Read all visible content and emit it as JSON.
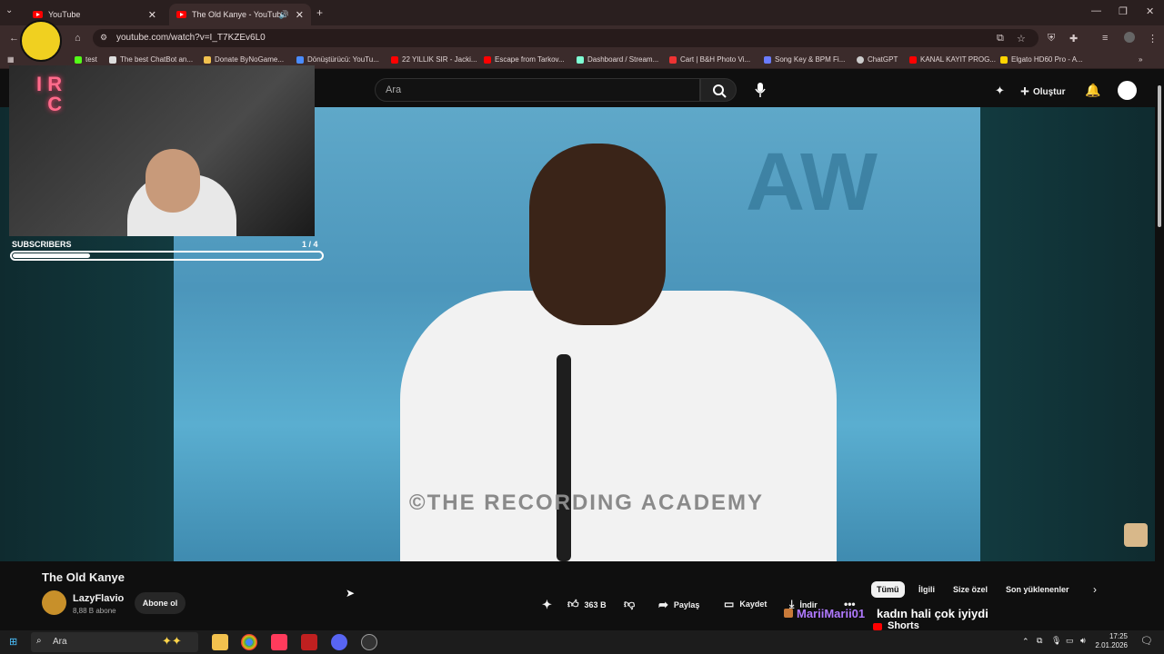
{
  "browser": {
    "tabs": [
      {
        "label": "YouTube",
        "active": false
      },
      {
        "label": "The Old Kanye - YouTube",
        "active": true
      }
    ],
    "url": "youtube.com/watch?v=I_T7KZEv6L0",
    "bookmarks": [
      "test",
      "The best ChatBot an...",
      "Donate ByNoGame...",
      "Dönüştürücü: YouTu...",
      "22 YILLIK SIR - Jacki...",
      "Escape from Tarkov...",
      "Dashboard / Stream...",
      "Cart | B&H Photo Vi...",
      "Song Key & BPM Fi...",
      "ChatGPT",
      "KANAL KAYIT PROG...",
      "Elgato HD60 Pro - A..."
    ]
  },
  "youtube": {
    "search_placeholder": "Ara",
    "create_label": "Oluştur",
    "video_title": "The Old Kanye",
    "channel_name": "LazyFlavio",
    "channel_subs": "8,88 B abone",
    "subscribe_label": "Abone ol",
    "likes": "363 B",
    "share_label": "Paylaş",
    "save_label": "Kaydet",
    "download_label": "İndir",
    "chips": [
      "Tümü",
      "İlgili",
      "Size özel",
      "Son yüklenenler"
    ],
    "video_watermark": "©THE RECORDING ACADEMY"
  },
  "stream_overlay": {
    "brand": "IRONIC",
    "subs_label": "SUBSCRIBERS",
    "subs_count": "1 / 4",
    "subs_progress": 0.25,
    "chat_user": "MariiMarii01",
    "chat_message": "kadın hali çok iyiydi",
    "chat_sub": "Shorts"
  },
  "taskbar": {
    "search_placeholder": "Ara",
    "time": "17:25",
    "date": "2.01.2026"
  }
}
